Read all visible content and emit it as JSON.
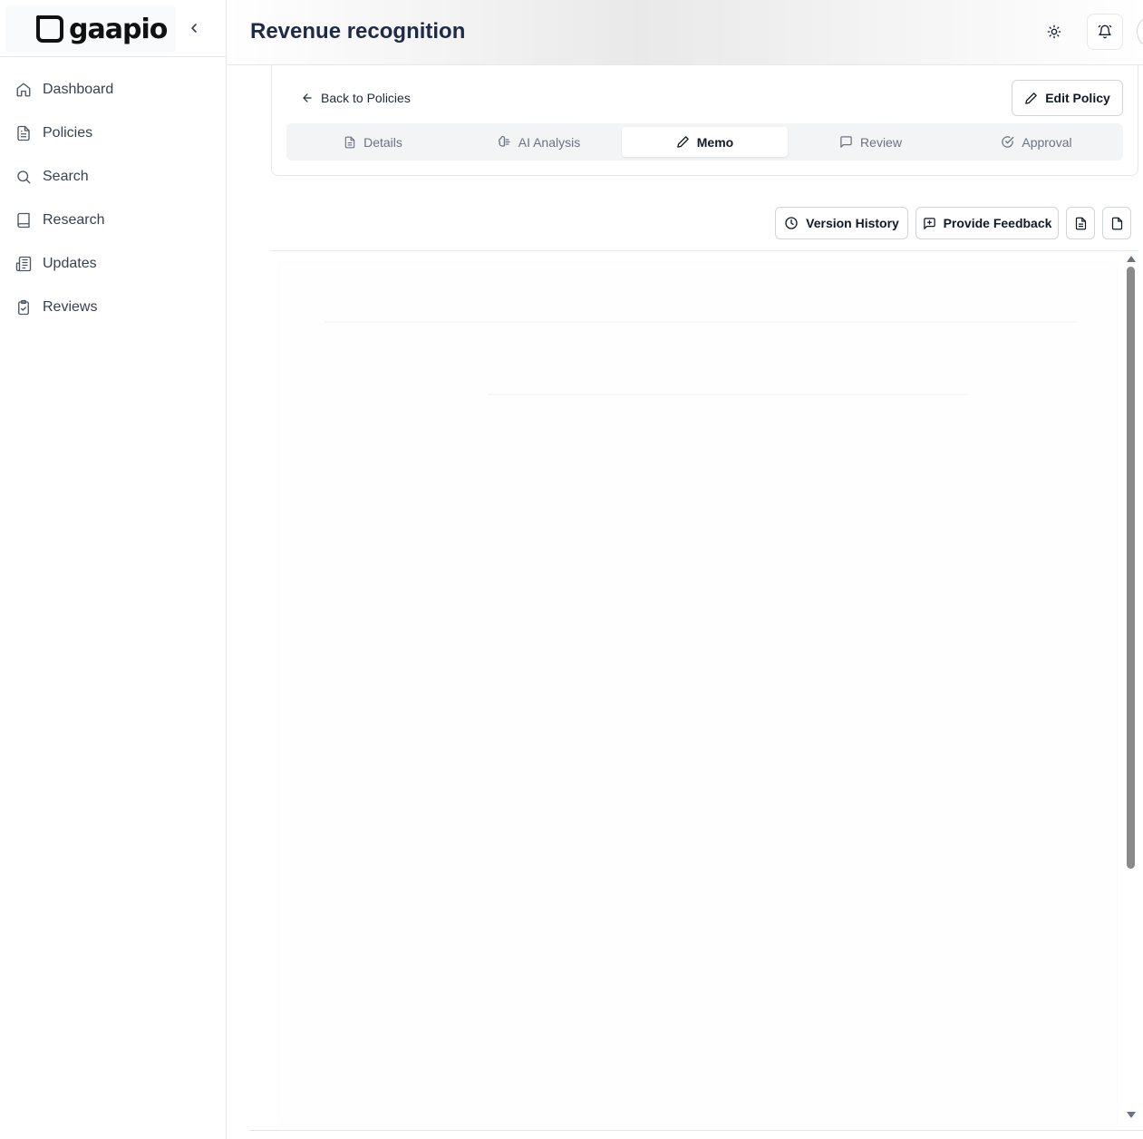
{
  "brand": {
    "name": "gaapio"
  },
  "sidebar": {
    "items": [
      {
        "label": "Dashboard",
        "icon": "home-icon"
      },
      {
        "label": "Policies",
        "icon": "file-text-icon"
      },
      {
        "label": "Search",
        "icon": "search-icon"
      },
      {
        "label": "Research",
        "icon": "book-icon"
      },
      {
        "label": "Updates",
        "icon": "newspaper-icon"
      },
      {
        "label": "Reviews",
        "icon": "clipboard-check-icon"
      }
    ]
  },
  "header": {
    "title": "Revenue recognition"
  },
  "policy": {
    "back_label": "Back to Policies",
    "edit_label": "Edit Policy",
    "tabs": [
      {
        "label": "Details",
        "icon": "file-icon"
      },
      {
        "label": "AI Analysis",
        "icon": "brain-icon"
      },
      {
        "label": "Memo",
        "icon": "pencil-icon",
        "active": true
      },
      {
        "label": "Review",
        "icon": "message-square-icon"
      },
      {
        "label": "Approval",
        "icon": "check-circle-icon"
      }
    ]
  },
  "toolbar": {
    "version_history_label": "Version History",
    "feedback_label": "Provide Feedback"
  },
  "colors": {
    "title": "#1e2a4a",
    "border": "#e5e7eb",
    "tab_bg": "#f3f4f6",
    "muted_text": "#6b7280"
  }
}
